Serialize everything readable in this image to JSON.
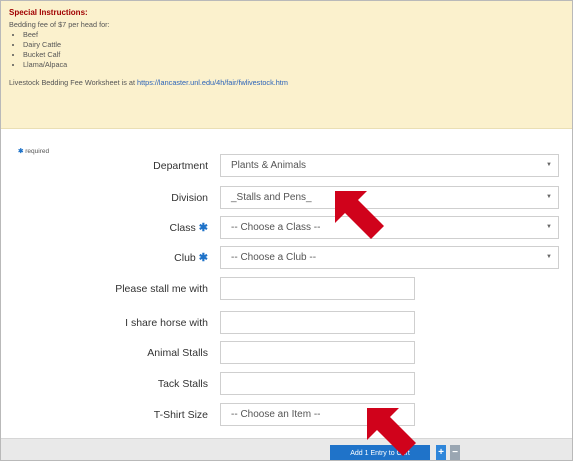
{
  "notice": {
    "title": "Special Instructions:",
    "intro": "Bedding fee of $7 per head for:",
    "items": [
      "Beef",
      "Dairy Cattle",
      "Bucket Calf",
      "Llama/Alpaca"
    ],
    "worksheet_text": "Livestock Bedding Fee Worksheet is at ",
    "worksheet_link": "https://lancaster.unl.edu/4h/fair/fwlivestock.htm"
  },
  "required_legend": "required",
  "form": {
    "department": {
      "label": "Department",
      "value": "Plants & Animals"
    },
    "division": {
      "label": "Division",
      "value": "_Stalls and Pens_"
    },
    "class": {
      "label": "Class",
      "value": "-- Choose a Class --"
    },
    "club": {
      "label": "Club",
      "value": "-- Choose a Club --"
    },
    "stall_with": {
      "label": "Please stall me with",
      "value": ""
    },
    "share_horse": {
      "label": "I share horse with",
      "value": ""
    },
    "animal_stalls": {
      "label": "Animal Stalls",
      "value": ""
    },
    "tack_stalls": {
      "label": "Tack Stalls",
      "value": ""
    },
    "tshirt": {
      "label": "T-Shirt Size",
      "value": "-- Choose an Item --"
    }
  },
  "footer": {
    "add_label": "Add 1 Entry to Cart",
    "plus": "+",
    "minus": "−"
  },
  "colors": {
    "accent": "#1f73c9",
    "notice_bg": "#fbf1cd",
    "arrow": "#d0021b"
  }
}
